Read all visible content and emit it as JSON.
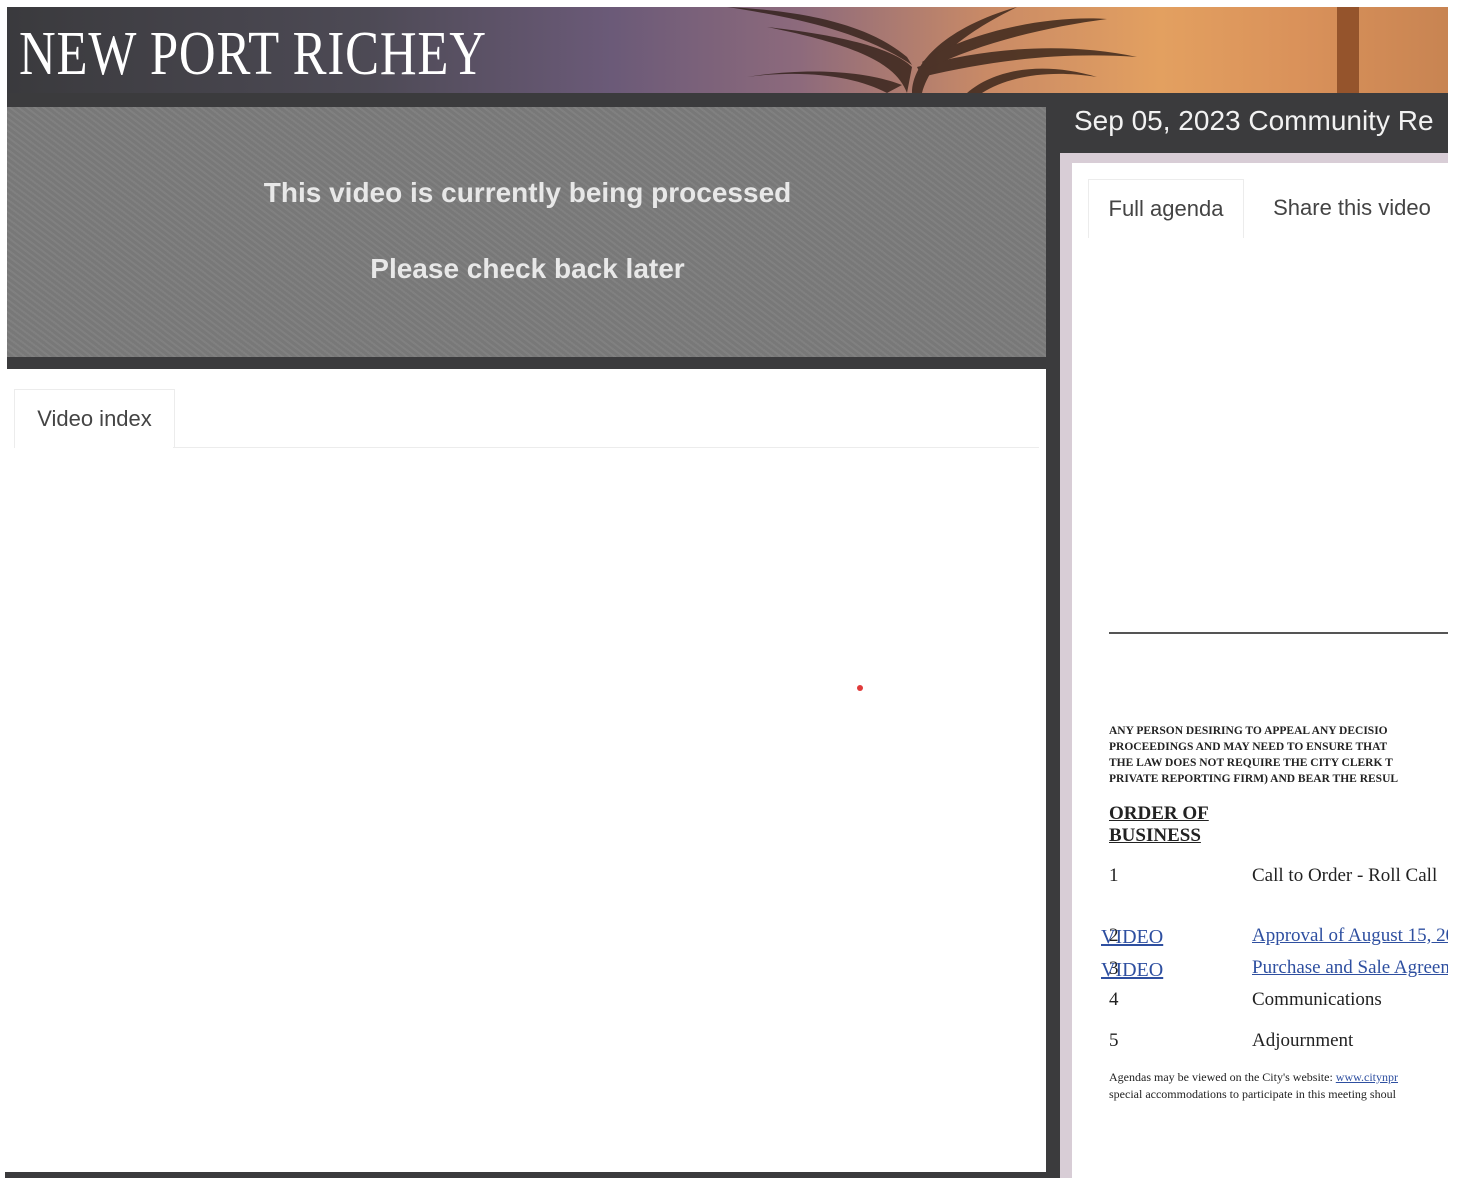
{
  "header": {
    "logo_text": "NEW PORT RICHEY"
  },
  "video": {
    "message_line1": "This video is currently being processed",
    "message_line2": "Please check back later"
  },
  "left_tabs": {
    "video_index": "Video index"
  },
  "meeting": {
    "title": "Sep 05, 2023 Community Re"
  },
  "right_tabs": {
    "full_agenda": "Full agenda",
    "share_video": "Share this video"
  },
  "agenda": {
    "notice_lines": [
      "ANY PERSON DESIRING TO APPEAL ANY DECISIO",
      "PROCEEDINGS AND MAY NEED TO ENSURE THAT",
      "THE LAW DOES NOT REQUIRE THE CITY CLERK T",
      "PRIVATE REPORTING FIRM) AND BEAR THE RESUL"
    ],
    "order_heading": "ORDER OF BUSINESS",
    "items": [
      {
        "num": "1",
        "title": "Call to Order - Roll Call",
        "video": ""
      },
      {
        "num": "2",
        "title": "Approval of August 15, 20",
        "video": "VIDEO"
      },
      {
        "num": "3",
        "title": "Purchase and Sale Agreem",
        "video": "VIDEO"
      },
      {
        "num": "4",
        "title": "Communications",
        "video": ""
      },
      {
        "num": "5",
        "title": "Adjournment",
        "video": ""
      }
    ],
    "footer_line1_prefix": "Agendas may be viewed on the City's website:",
    "footer_line1_link": "www.citynpr",
    "footer_line2": "special accommodations to participate in this meeting shoul"
  },
  "colors": {
    "dark_frame": "#3b3b3d",
    "video_bg": "#7c7c7c",
    "link_blue": "#2e4fa0",
    "right_border": "#d8cdd6"
  }
}
